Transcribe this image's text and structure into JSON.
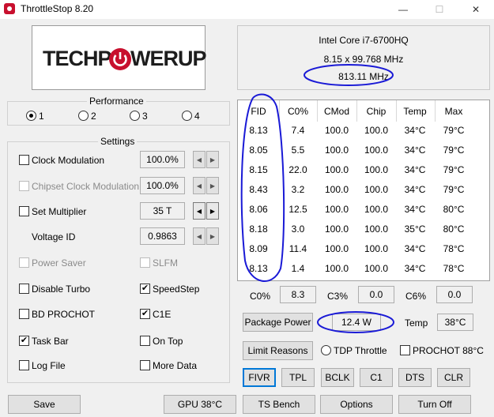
{
  "window": {
    "title": "ThrottleStop 8.20",
    "buttons": {
      "minimize": "—",
      "maximize": "☐",
      "close": "✕"
    }
  },
  "logo": {
    "part1": "TECHP",
    "part2": "WERUP",
    "accent": "#c8102e"
  },
  "cpu": {
    "name": "Intel Core i7-6700HQ",
    "multiplier": "8.15 x 99.768 MHz",
    "speed": "813.11 MHz"
  },
  "performance": {
    "title": "Performance",
    "options": [
      "1",
      "2",
      "3",
      "4"
    ],
    "selected": "1"
  },
  "settings": {
    "title": "Settings",
    "clock_modulation": {
      "label": "Clock Modulation",
      "value": "100.0%",
      "checked": false
    },
    "chipset_clock_modulation": {
      "label": "Chipset Clock Modulation",
      "value": "100.0%",
      "checked": false
    },
    "set_multiplier": {
      "label": "Set Multiplier",
      "value": "35 T",
      "checked": false
    },
    "voltage_id": {
      "label": "Voltage ID",
      "value": "0.9863"
    },
    "power_saver": {
      "label": "Power Saver",
      "checked": false
    },
    "slfm": {
      "label": "SLFM",
      "checked": false
    },
    "disable_turbo": {
      "label": "Disable Turbo",
      "checked": false
    },
    "speedstep": {
      "label": "SpeedStep",
      "checked": true
    },
    "bd_prochot": {
      "label": "BD PROCHOT",
      "checked": false
    },
    "c1e": {
      "label": "C1E",
      "checked": true
    },
    "task_bar": {
      "label": "Task Bar",
      "checked": true
    },
    "on_top": {
      "label": "On Top",
      "checked": false
    },
    "log_file": {
      "label": "Log File",
      "checked": false
    },
    "more_data": {
      "label": "More Data",
      "checked": false
    }
  },
  "table": {
    "headers": [
      "FID",
      "C0%",
      "CMod",
      "Chip",
      "Temp",
      "Max"
    ],
    "rows": [
      [
        "8.13",
        "7.4",
        "100.0",
        "100.0",
        "34°C",
        "79°C"
      ],
      [
        "8.05",
        "5.5",
        "100.0",
        "100.0",
        "34°C",
        "79°C"
      ],
      [
        "8.15",
        "22.0",
        "100.0",
        "100.0",
        "34°C",
        "79°C"
      ],
      [
        "8.43",
        "3.2",
        "100.0",
        "100.0",
        "34°C",
        "79°C"
      ],
      [
        "8.06",
        "12.5",
        "100.0",
        "100.0",
        "34°C",
        "80°C"
      ],
      [
        "8.18",
        "3.0",
        "100.0",
        "100.0",
        "35°C",
        "80°C"
      ],
      [
        "8.09",
        "11.4",
        "100.0",
        "100.0",
        "34°C",
        "78°C"
      ],
      [
        "8.13",
        "1.4",
        "100.0",
        "100.0",
        "34°C",
        "78°C"
      ]
    ]
  },
  "cstates": {
    "c0_label": "C0%",
    "c0_value": "8.3",
    "c3_label": "C3%",
    "c3_value": "0.0",
    "c6_label": "C6%",
    "c6_value": "0.0"
  },
  "package": {
    "button": "Package Power",
    "value": "12.4 W",
    "temp_label": "Temp",
    "temp_value": "38°C"
  },
  "limits": {
    "button": "Limit Reasons",
    "tdp_throttle": "TDP Throttle",
    "prochot": "PROCHOT 88°C"
  },
  "tools": [
    "FIVR",
    "TPL",
    "BCLK",
    "C1",
    "DTS",
    "CLR"
  ],
  "bottom": {
    "save": "Save",
    "gpu": "GPU 38°C",
    "ts_bench": "TS Bench",
    "options": "Options",
    "turn_off": "Turn Off"
  },
  "annotation_color": "#1a1ad6"
}
